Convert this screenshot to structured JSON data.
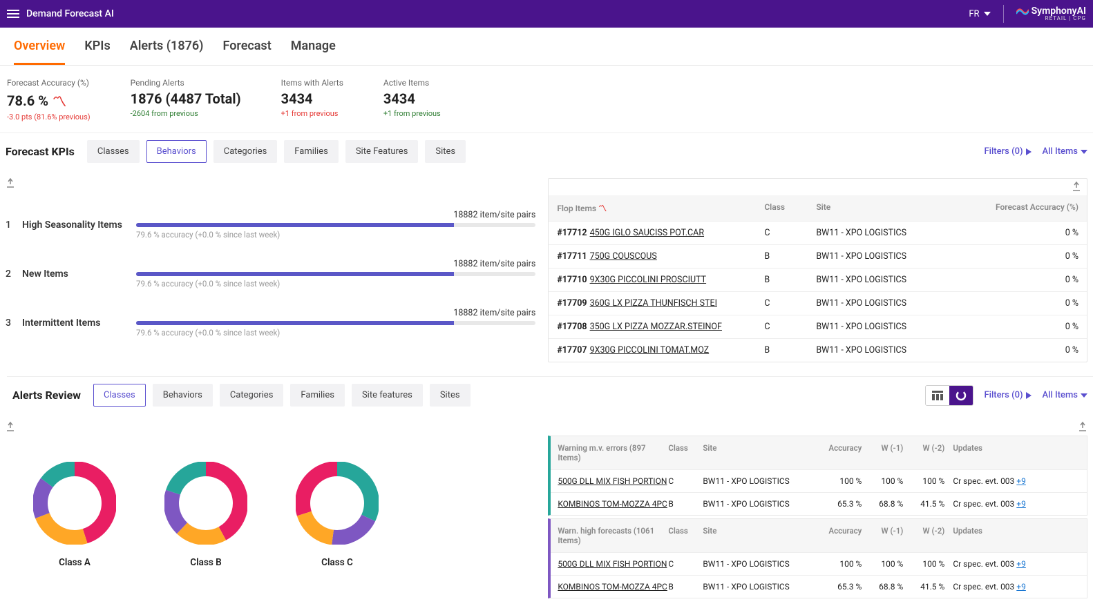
{
  "header": {
    "app_title": "Demand Forecast AI",
    "lang": "FR",
    "logo_main": "SymphonyAI",
    "logo_sub": "RETAIL | CPG"
  },
  "tabs": [
    {
      "label": "Overview",
      "active": true
    },
    {
      "label": "KPIs"
    },
    {
      "label": "Alerts (1876)"
    },
    {
      "label": "Forecast"
    },
    {
      "label": "Manage"
    }
  ],
  "metrics": [
    {
      "label": "Forecast Accuracy (%)",
      "value": "78.6 %",
      "trend": "down",
      "sub": "-3.0 pts (81.6% previous)",
      "cls": "red"
    },
    {
      "label": "Pending Alerts",
      "value": "1876 (4487 Total)",
      "sub": "-2604 from previous",
      "cls": "green"
    },
    {
      "label": "Items with Alerts",
      "value": "3434",
      "sub": "+1 from previous",
      "cls": "red"
    },
    {
      "label": "Active Items",
      "value": "3434",
      "sub": "+1 from previous",
      "cls": "green"
    }
  ],
  "kpi_section": {
    "title": "Forecast KPIs",
    "chips": [
      "Classes",
      "Behaviors",
      "Categories",
      "Families",
      "Site Features",
      "Sites"
    ],
    "active_chip": "Behaviors",
    "filters_label": "Filters (0)",
    "allitems_label": "All Items"
  },
  "kpi_rows": [
    {
      "n": "1",
      "name": "High Seasonality Items",
      "pairs": "18882 item/site pairs",
      "fill": 79.6,
      "acc": "79.6 % accuracy (+0.0 % since last week)"
    },
    {
      "n": "2",
      "name": "New Items",
      "pairs": "18882 item/site pairs",
      "fill": 79.6,
      "acc": "79.6 % accuracy (+0.0 % since last week)"
    },
    {
      "n": "3",
      "name": "Intermittent Items",
      "pairs": "18882 item/site pairs",
      "fill": 79.6,
      "acc": "79.6 % accuracy (+0.0 % since last week)"
    }
  ],
  "flop": {
    "head": {
      "items": "Flop Items",
      "class": "Class",
      "site": "Site",
      "acc": "Forecast Accuracy (%)"
    },
    "rows": [
      {
        "id": "#17712",
        "name": "450G IGLO SAUCISS POT.CAR",
        "class": "C",
        "site": "BW11 - XPO LOGISTICS",
        "acc": "0 %"
      },
      {
        "id": "#17711",
        "name": "750G COUSCOUS",
        "class": "B",
        "site": "BW11 - XPO LOGISTICS",
        "acc": "0 %"
      },
      {
        "id": "#17710",
        "name": "9X30G PICCOLINI PROSCIUTT",
        "class": "B",
        "site": "BW11 - XPO LOGISTICS",
        "acc": "0 %"
      },
      {
        "id": "#17709",
        "name": "360G LX PIZZA THUNFISCH STEI",
        "class": "C",
        "site": "BW11 - XPO LOGISTICS",
        "acc": "0 %"
      },
      {
        "id": "#17708",
        "name": "350G LX PIZZA MOZZAR.STEINOF",
        "class": "C",
        "site": "BW11 - XPO LOGISTICS",
        "acc": "0 %"
      },
      {
        "id": "#17707",
        "name": "9X30G PICCOLINI TOMAT.MOZ",
        "class": "B",
        "site": "BW11 - XPO LOGISTICS",
        "acc": "0 %"
      }
    ]
  },
  "alerts_section": {
    "title": "Alerts Review",
    "chips": [
      "Classes",
      "Behaviors",
      "Categories",
      "Families",
      "Site features",
      "Sites"
    ],
    "active_chip": "Classes",
    "filters_label": "Filters (0)",
    "allitems_label": "All Items"
  },
  "chart_data": [
    {
      "type": "pie",
      "title": "Class A",
      "categories": [
        "pink",
        "orange",
        "purple",
        "teal"
      ],
      "values": [
        45,
        24,
        16,
        15
      ]
    },
    {
      "type": "pie",
      "title": "Class B",
      "categories": [
        "pink",
        "orange",
        "purple",
        "teal"
      ],
      "values": [
        42,
        20,
        18,
        20
      ]
    },
    {
      "type": "pie",
      "title": "Class C",
      "categories": [
        "teal",
        "purple",
        "orange",
        "pink"
      ],
      "values": [
        32,
        20,
        18,
        30
      ]
    }
  ],
  "donut_colors": {
    "pink": "#e91e63",
    "orange": "#ffa726",
    "purple": "#7e57c2",
    "teal": "#26a69a"
  },
  "alerts_tables": [
    {
      "color": "teal",
      "head": "Warning m.v. errors (897 Items)",
      "cols": {
        "class": "Class",
        "site": "Site",
        "acc": "Accuracy",
        "w1": "W (-1)",
        "w2": "W (-2)",
        "upd": "Updates"
      },
      "rows": [
        {
          "name": "500G DLL MIX FISH PORTION",
          "class": "C",
          "site": "BW11 - XPO LOGISTICS",
          "acc": "100 %",
          "w1": "100 %",
          "w2": "100 %",
          "upd": "Cr spec. evt. 003",
          "more": "+9"
        },
        {
          "name": "KOMBINOS TOM-MOZZA 4PC",
          "class": "B",
          "site": "BW11 - XPO LOGISTICS",
          "acc": "65.3 %",
          "w1": "68.8 %",
          "w2": "41.5 %",
          "upd": "Cr spec. evt. 003",
          "more": "+9"
        }
      ]
    },
    {
      "color": "purple",
      "head": "Warn. high forecasts (1061 Items)",
      "cols": {
        "class": "Class",
        "site": "Site",
        "acc": "Accuracy",
        "w1": "W (-1)",
        "w2": "W (-2)",
        "upd": "Updates"
      },
      "rows": [
        {
          "name": "500G DLL MIX FISH PORTION",
          "class": "C",
          "site": "BW11 - XPO LOGISTICS",
          "acc": "100 %",
          "w1": "100 %",
          "w2": "100 %",
          "upd": "Cr spec. evt. 003",
          "more": "+9"
        },
        {
          "name": "KOMBINOS TOM-MOZZA 4PC",
          "class": "B",
          "site": "BW11 - XPO LOGISTICS",
          "acc": "65.3 %",
          "w1": "68.8 %",
          "w2": "41.5 %",
          "upd": "Cr spec. evt. 003",
          "more": "+9"
        }
      ]
    }
  ]
}
